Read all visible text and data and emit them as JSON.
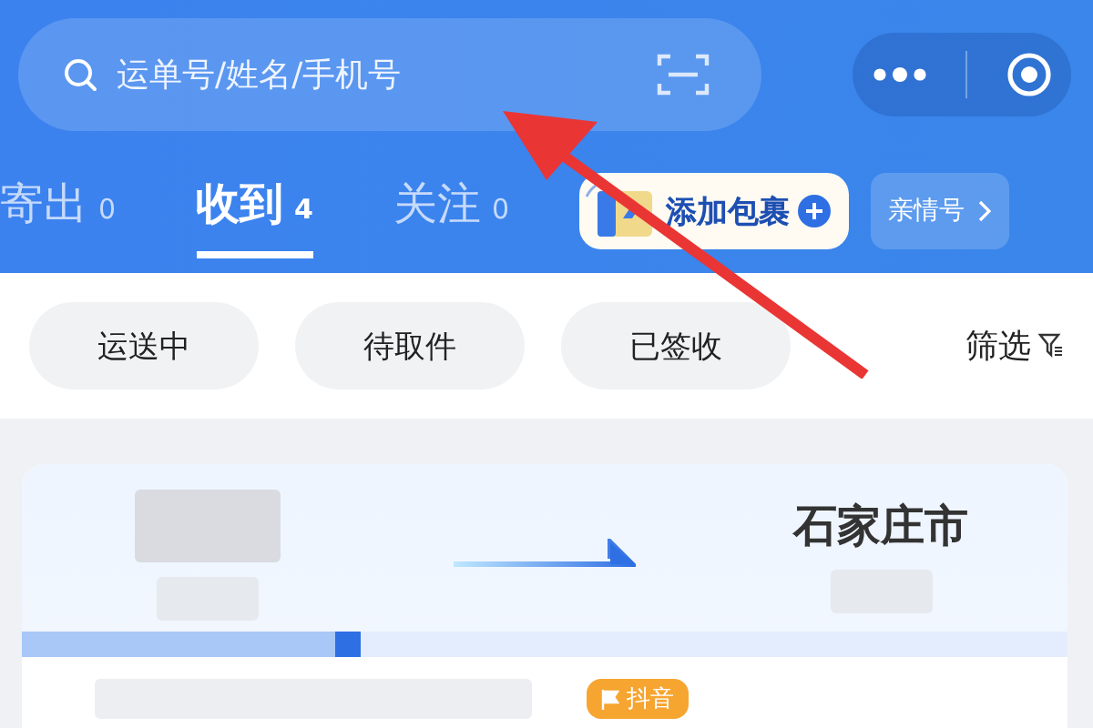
{
  "search": {
    "placeholder": "运单号/姓名/手机号"
  },
  "tabs": [
    {
      "label": "寄出",
      "count": "0",
      "selected": false
    },
    {
      "label": "收到",
      "count": "4",
      "selected": true
    },
    {
      "label": "关注",
      "count": "0",
      "selected": false
    }
  ],
  "add_parcel_button": {
    "label": "添加包裹"
  },
  "family_button": {
    "label": "亲情号"
  },
  "filters": [
    {
      "label": "运送中",
      "selected": false
    },
    {
      "label": "待取件",
      "selected": false
    },
    {
      "label": "已签收",
      "selected": false
    }
  ],
  "filter_button": {
    "label": "筛选"
  },
  "parcel": {
    "destination": "石家庄市",
    "progress": {
      "level": 0.3
    },
    "tag": "抖音"
  }
}
